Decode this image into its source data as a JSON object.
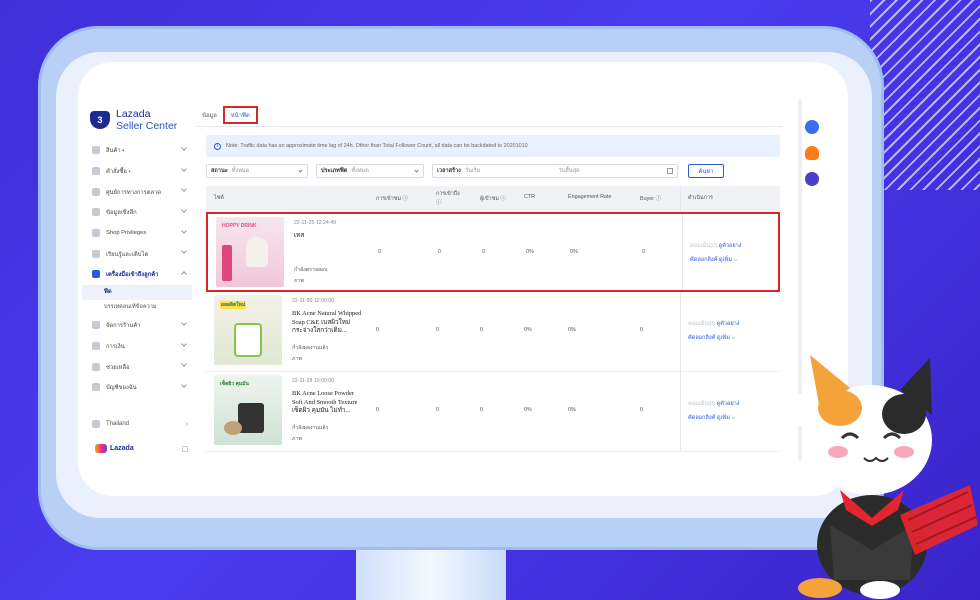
{
  "sidebar": {
    "brand_line1": "Lazada",
    "brand_line2": "Seller Center",
    "brand_badge": "3",
    "items": [
      {
        "label": "สินค้า •"
      },
      {
        "label": "คำสั่งซื้อ •"
      },
      {
        "label": "ศูนย์การทางการตลาด"
      },
      {
        "label": "ข้อมูลเชิงลึก"
      },
      {
        "label": "Shop Privileges"
      },
      {
        "label": "เรียนรู้และเติบโต"
      },
      {
        "label": "เครื่องมือเข้าถึงลูกค้า"
      }
    ],
    "subitems": [
      {
        "label": "ฟีด"
      },
      {
        "label": "บรรเทคอนเท้ข้อความ"
      }
    ],
    "items2": [
      {
        "label": "จัดการร้านค้า"
      },
      {
        "label": "การเงิน"
      },
      {
        "label": "ช่วยเหลือ"
      },
      {
        "label": "บัญชีของฉัน"
      }
    ],
    "country": "Thailand",
    "footer_brand": "Lazada"
  },
  "tabs": [
    {
      "label": "ข้อมูล"
    },
    {
      "label": "หน้าฟีด"
    }
  ],
  "notice": "Note: Traffic data has an approximate time lag of 24h. Other than Total Follower Count, all data can be backdated to 20201010",
  "filters": {
    "status_label": "สถานะ",
    "status_value": "ทั้งหมด",
    "type_label": "ประเภทฟีด",
    "type_value": "ทั้งหมด",
    "time_label": "เวลาสร้าง",
    "start_placeholder": "วันเริ่ม",
    "end_placeholder": "วันสิ้นสุด",
    "search_button": "ค้นหา"
  },
  "table": {
    "headers": [
      "ไซต์",
      "การเข้าชม ⓘ",
      "การเข้าถึง ⓘ",
      "ผู้เข้าชม ⓘ",
      "CTR",
      "Engagement Rate",
      "Buyer ⓘ",
      "ดำเนินการ"
    ],
    "rows": [
      {
        "date": "22-11-25 12:24:49",
        "title": "เทส",
        "status": "กำลังตรวจสอบ",
        "sub": "ภาพ",
        "visits": "0",
        "reach": "0",
        "visitors": "0",
        "ctr": "0%",
        "er": "0%",
        "buyer": "0",
        "act1": "คอมเม้น(0)",
        "act2": "ดูตัวอย่าง",
        "act3": "คัดลอกลิงค์",
        "act4": "ดูเพิ่ม",
        "thumb_text": "HOPPY DRINK",
        "thumb_color": "#f6dbe6"
      },
      {
        "date": "22-11-30 12:00:00",
        "title": "BK Acne Natural Whipped Soap C&E เบสผิวใหม่ กระจ่างใสกว่าเดิม...",
        "status": "กำลังผลงานแล้ว",
        "sub": "ภาพ",
        "visits": "0",
        "reach": "0",
        "visitors": "0",
        "ctr": "0%",
        "er": "0%",
        "buyer": "0",
        "act1": "คอมเม้น(0)",
        "act2": "ดูตัวอย่าง",
        "act3": "คัดลอกลิงค์",
        "act4": "ดูเพิ่ม",
        "thumb_text": "ผลผลิตใหม่",
        "thumb_color": "#eef4e6"
      },
      {
        "date": "22-11-28 10:00:00",
        "title": "BK Acne Loose Powder Soft And Smooth Texture เซ็ตผิว คุมมัน ไม่ทำ...",
        "status": "กำลังผลงานแล้ว",
        "sub": "ภาพ",
        "visits": "0",
        "reach": "0",
        "visitors": "0",
        "ctr": "0%",
        "er": "0%",
        "buyer": "0",
        "act1": "คอมเม้น(0)",
        "act2": "ดูตัวอย่าง",
        "act3": "คัดลอกลิงค์",
        "act4": "ดูเพิ่ม",
        "thumb_text": "เซ็ตผิว คุมมัน",
        "thumb_color": "#e3eee8"
      }
    ]
  },
  "colors": {
    "accent": "#2a5bd7",
    "highlight": "#d62828",
    "brand": "#1a2c8f",
    "background": "#3f2fd8"
  }
}
